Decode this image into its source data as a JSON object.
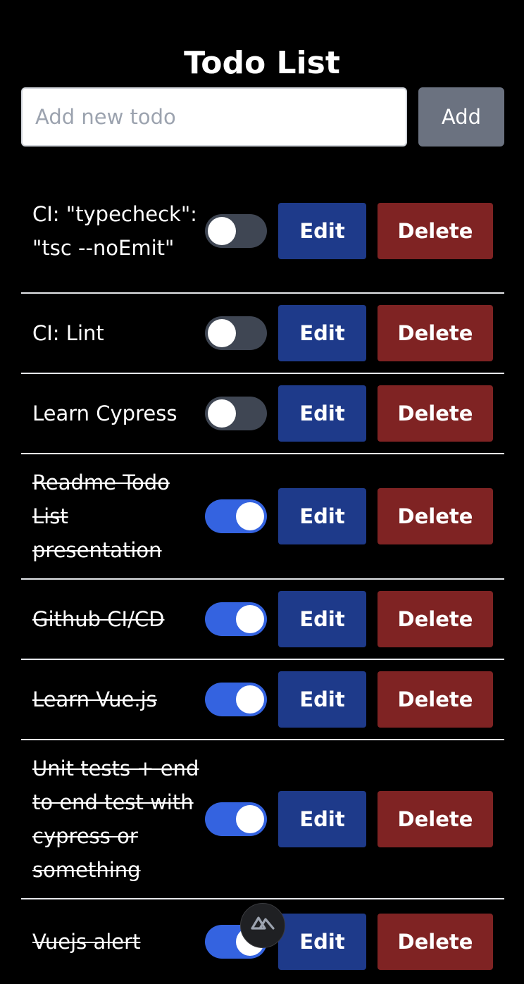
{
  "header": {
    "title": "Todo List"
  },
  "new_todo": {
    "placeholder": "Add new todo",
    "value": "",
    "add_label": "Add"
  },
  "todos": [
    {
      "text": "CI: \"typecheck\": \"tsc --noEmit\"",
      "done": false,
      "edit_label": "Edit",
      "delete_label": "Delete"
    },
    {
      "text": "CI: Lint",
      "done": false,
      "edit_label": "Edit",
      "delete_label": "Delete"
    },
    {
      "text": "Learn Cypress",
      "done": false,
      "edit_label": "Edit",
      "delete_label": "Delete"
    },
    {
      "text": "Readme Todo List presentation",
      "done": true,
      "edit_label": "Edit",
      "delete_label": "Delete"
    },
    {
      "text": "Github CI/CD",
      "done": true,
      "edit_label": "Edit",
      "delete_label": "Delete"
    },
    {
      "text": "Learn Vue.js",
      "done": true,
      "edit_label": "Edit",
      "delete_label": "Delete"
    },
    {
      "text": "Unit tests + end to end test with cypress or something",
      "done": true,
      "edit_label": "Edit",
      "delete_label": "Delete"
    },
    {
      "text": "Vuejs alert",
      "done": true,
      "edit_label": "Edit",
      "delete_label": "Delete"
    }
  ],
  "devtools": {
    "icon": "nuxt-logo-icon"
  },
  "colors": {
    "background": "#000000",
    "toggle_on": "#3463e0",
    "toggle_off": "#3f4653",
    "edit_button": "#1e3a8a",
    "delete_button": "#7f2323",
    "add_button": "#6b7280"
  }
}
